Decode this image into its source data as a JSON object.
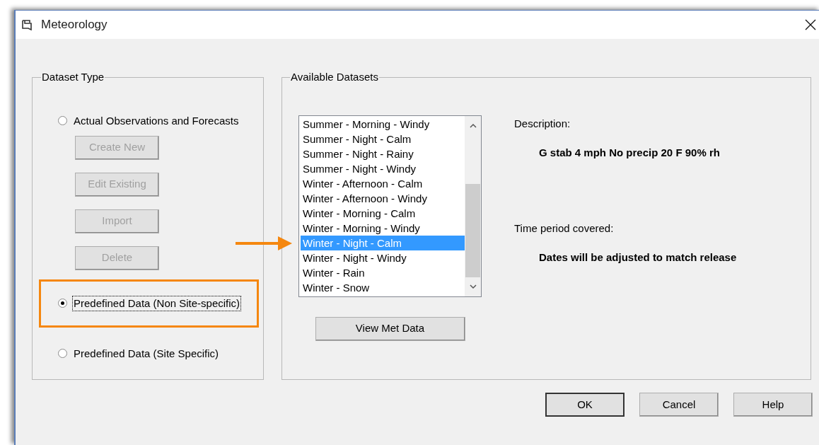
{
  "window": {
    "title": "Meteorology"
  },
  "dataset_type": {
    "legend": "Dataset Type",
    "options": [
      {
        "label": "Actual Observations and Forecasts",
        "selected": false,
        "focused": false,
        "highlighted": false
      },
      {
        "label": "Predefined Data (Non Site-specific)",
        "selected": true,
        "focused": true,
        "highlighted": true
      },
      {
        "label": "Predefined Data (Site Specific)",
        "selected": false,
        "focused": false,
        "highlighted": false
      }
    ],
    "buttons": [
      {
        "label": "Create New",
        "disabled": true
      },
      {
        "label": "Edit Existing",
        "disabled": true
      },
      {
        "label": "Import",
        "disabled": true
      },
      {
        "label": "Delete",
        "disabled": true
      }
    ]
  },
  "available_datasets": {
    "legend": "Available Datasets",
    "items": [
      {
        "label": "Summer - Morning - Windy",
        "selected": false,
        "pointed": false
      },
      {
        "label": "Summer - Night - Calm",
        "selected": false,
        "pointed": false
      },
      {
        "label": "Summer - Night - Rainy",
        "selected": false,
        "pointed": false
      },
      {
        "label": "Summer - Night - Windy",
        "selected": false,
        "pointed": false
      },
      {
        "label": "Winter - Afternoon - Calm",
        "selected": false,
        "pointed": false
      },
      {
        "label": "Winter - Afternoon - Windy",
        "selected": false,
        "pointed": false
      },
      {
        "label": "Winter - Morning - Calm",
        "selected": false,
        "pointed": false
      },
      {
        "label": "Winter - Morning - Windy",
        "selected": false,
        "pointed": false
      },
      {
        "label": "Winter - Night - Calm",
        "selected": true,
        "pointed": true
      },
      {
        "label": "Winter - Night - Windy",
        "selected": false,
        "pointed": false
      },
      {
        "label": "Winter - Rain",
        "selected": false,
        "pointed": false
      },
      {
        "label": "Winter - Snow",
        "selected": false,
        "pointed": false
      }
    ],
    "view_button": "View Met Data",
    "description_label": "Description:",
    "description": "G stab 4 mph No precip 20 F 90% rh",
    "time_period_label": "Time period covered:",
    "time_period": "Dates will be adjusted to match release"
  },
  "dialog_buttons": [
    {
      "label": "OK",
      "default": true
    },
    {
      "label": "Cancel",
      "default": false
    },
    {
      "label": "Help",
      "default": false
    }
  ]
}
